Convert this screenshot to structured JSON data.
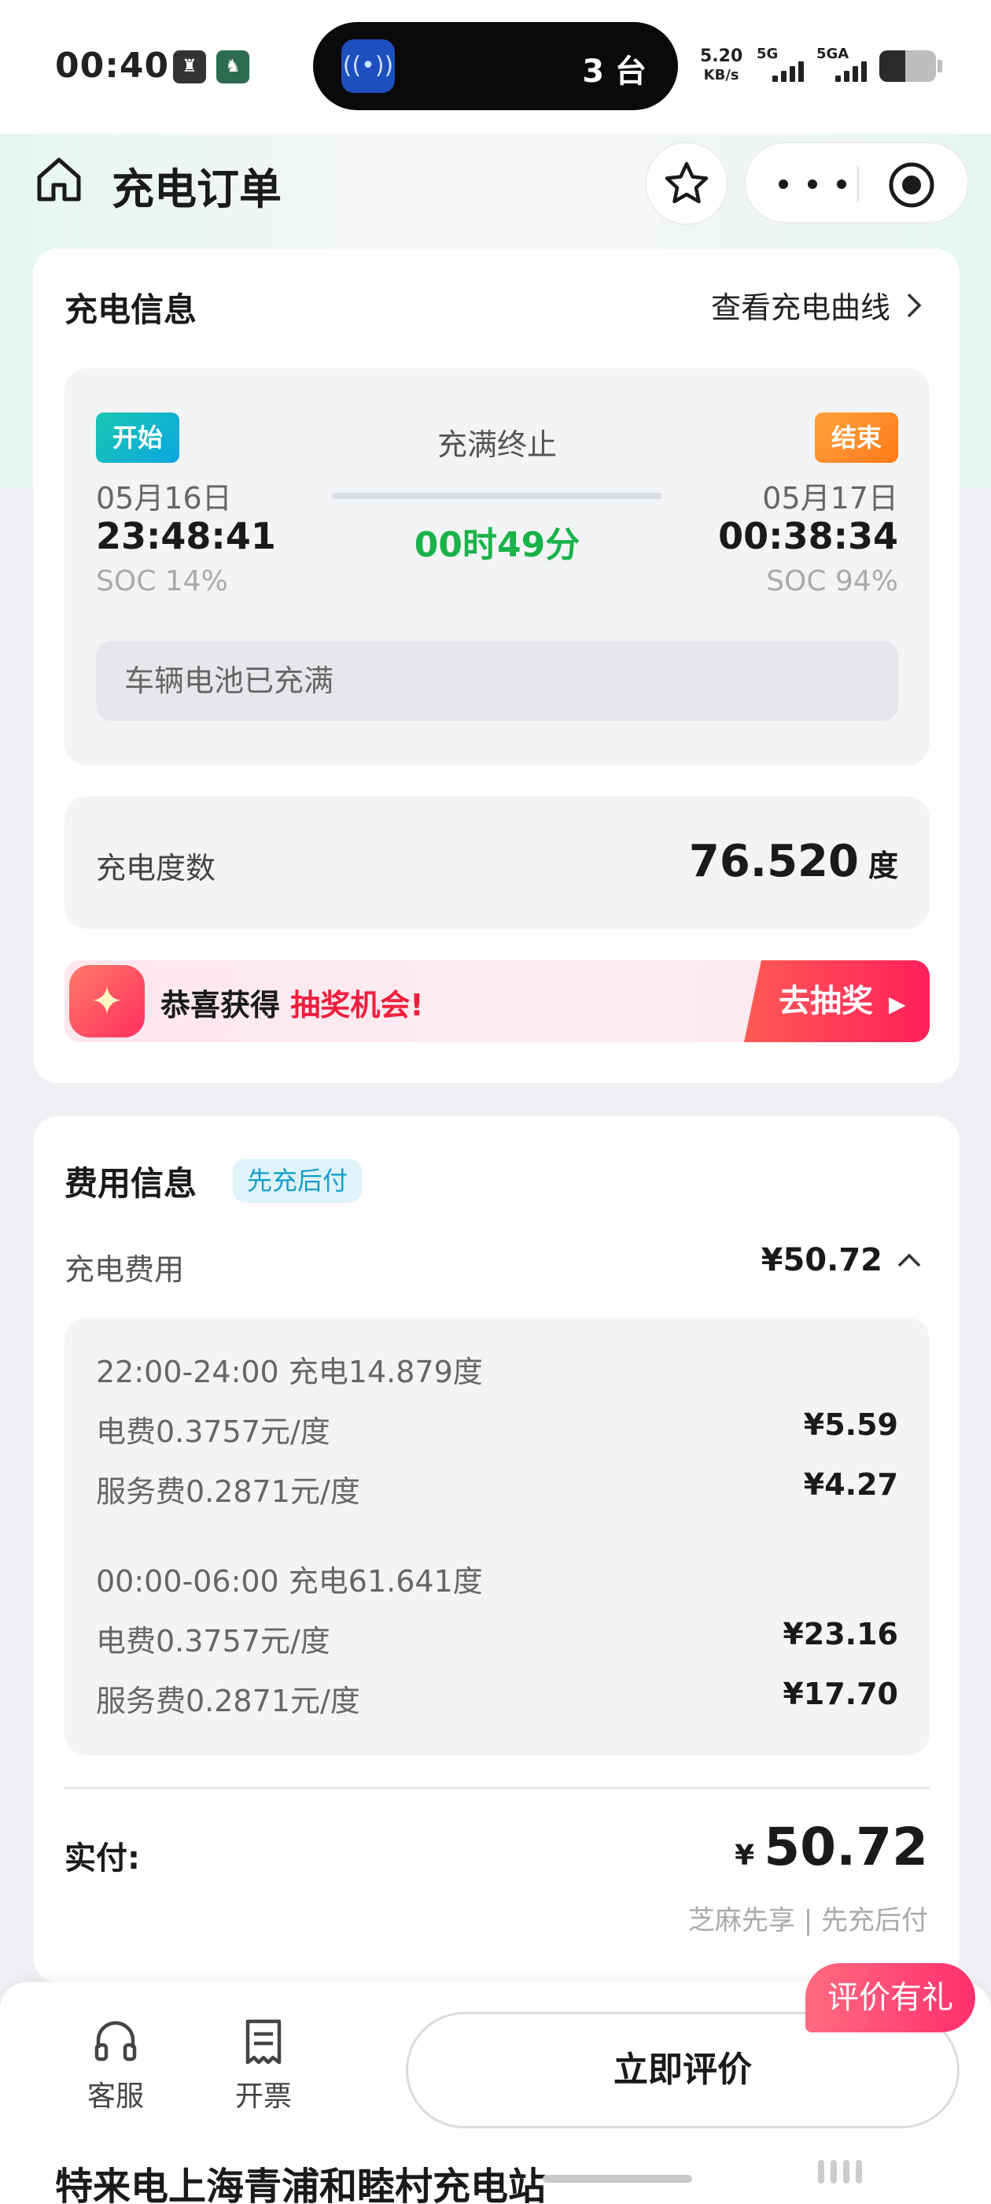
{
  "status_bar": {
    "time": "00:40",
    "island_text": "3 台",
    "island_icon": "broadcast-icon",
    "net_speed": "5.20",
    "net_unit": "KB/s",
    "signal_1": "5G",
    "signal_2": "5GA",
    "battery_level": 0.46
  },
  "header": {
    "title": "充电订单",
    "icons": [
      "home-icon",
      "star-icon",
      "more-icon",
      "close-target-icon"
    ]
  },
  "charging_info": {
    "title": "充电信息",
    "curve_link": "查看充电曲线",
    "start_badge": "开始",
    "end_badge": "结束",
    "stop_reason": "充满终止",
    "start_date": "05月16日",
    "start_time": "23:48:41",
    "start_soc": "SOC 14%",
    "end_date": "05月17日",
    "end_time": "00:38:34",
    "end_soc": "SOC 94%",
    "duration": "00时49分",
    "note": "车辆电池已充满",
    "kwh_label": "充电度数",
    "kwh_value": "76.520",
    "kwh_unit": "度",
    "colors": {
      "start": "#0aa6e0",
      "end": "#ff7a1a",
      "duration": "#19b34a"
    }
  },
  "lottery": {
    "text_prefix": "恭喜获得",
    "text_highlight": "抽奖机会!",
    "button": "去抽奖",
    "color": "#ee1f3d"
  },
  "fee_info": {
    "title": "费用信息",
    "tag": "先充后付",
    "charge_fee_label": "充电费用",
    "charge_fee_value": "¥50.72",
    "periods": [
      {
        "heading": "22:00-24:00 充电14.879度",
        "lines": [
          {
            "label": "电费0.3757元/度",
            "value": "¥5.59"
          },
          {
            "label": "服务费0.2871元/度",
            "value": "¥4.27"
          }
        ]
      },
      {
        "heading": "00:00-06:00 充电61.641度",
        "lines": [
          {
            "label": "电费0.3757元/度",
            "value": "¥23.16"
          },
          {
            "label": "服务费0.2871元/度",
            "value": "¥17.70"
          }
        ]
      }
    ],
    "paid_label": "实付:",
    "paid_currency": "¥",
    "paid_value": "50.72",
    "paid_sub": "芝麻先享 | 先充后付"
  },
  "bottom_bar": {
    "service_label": "客服",
    "invoice_label": "开票",
    "rate_button": "立即评价",
    "rate_badge": "评价有礼"
  },
  "station_name": "特来电上海青浦和睦村充电站"
}
